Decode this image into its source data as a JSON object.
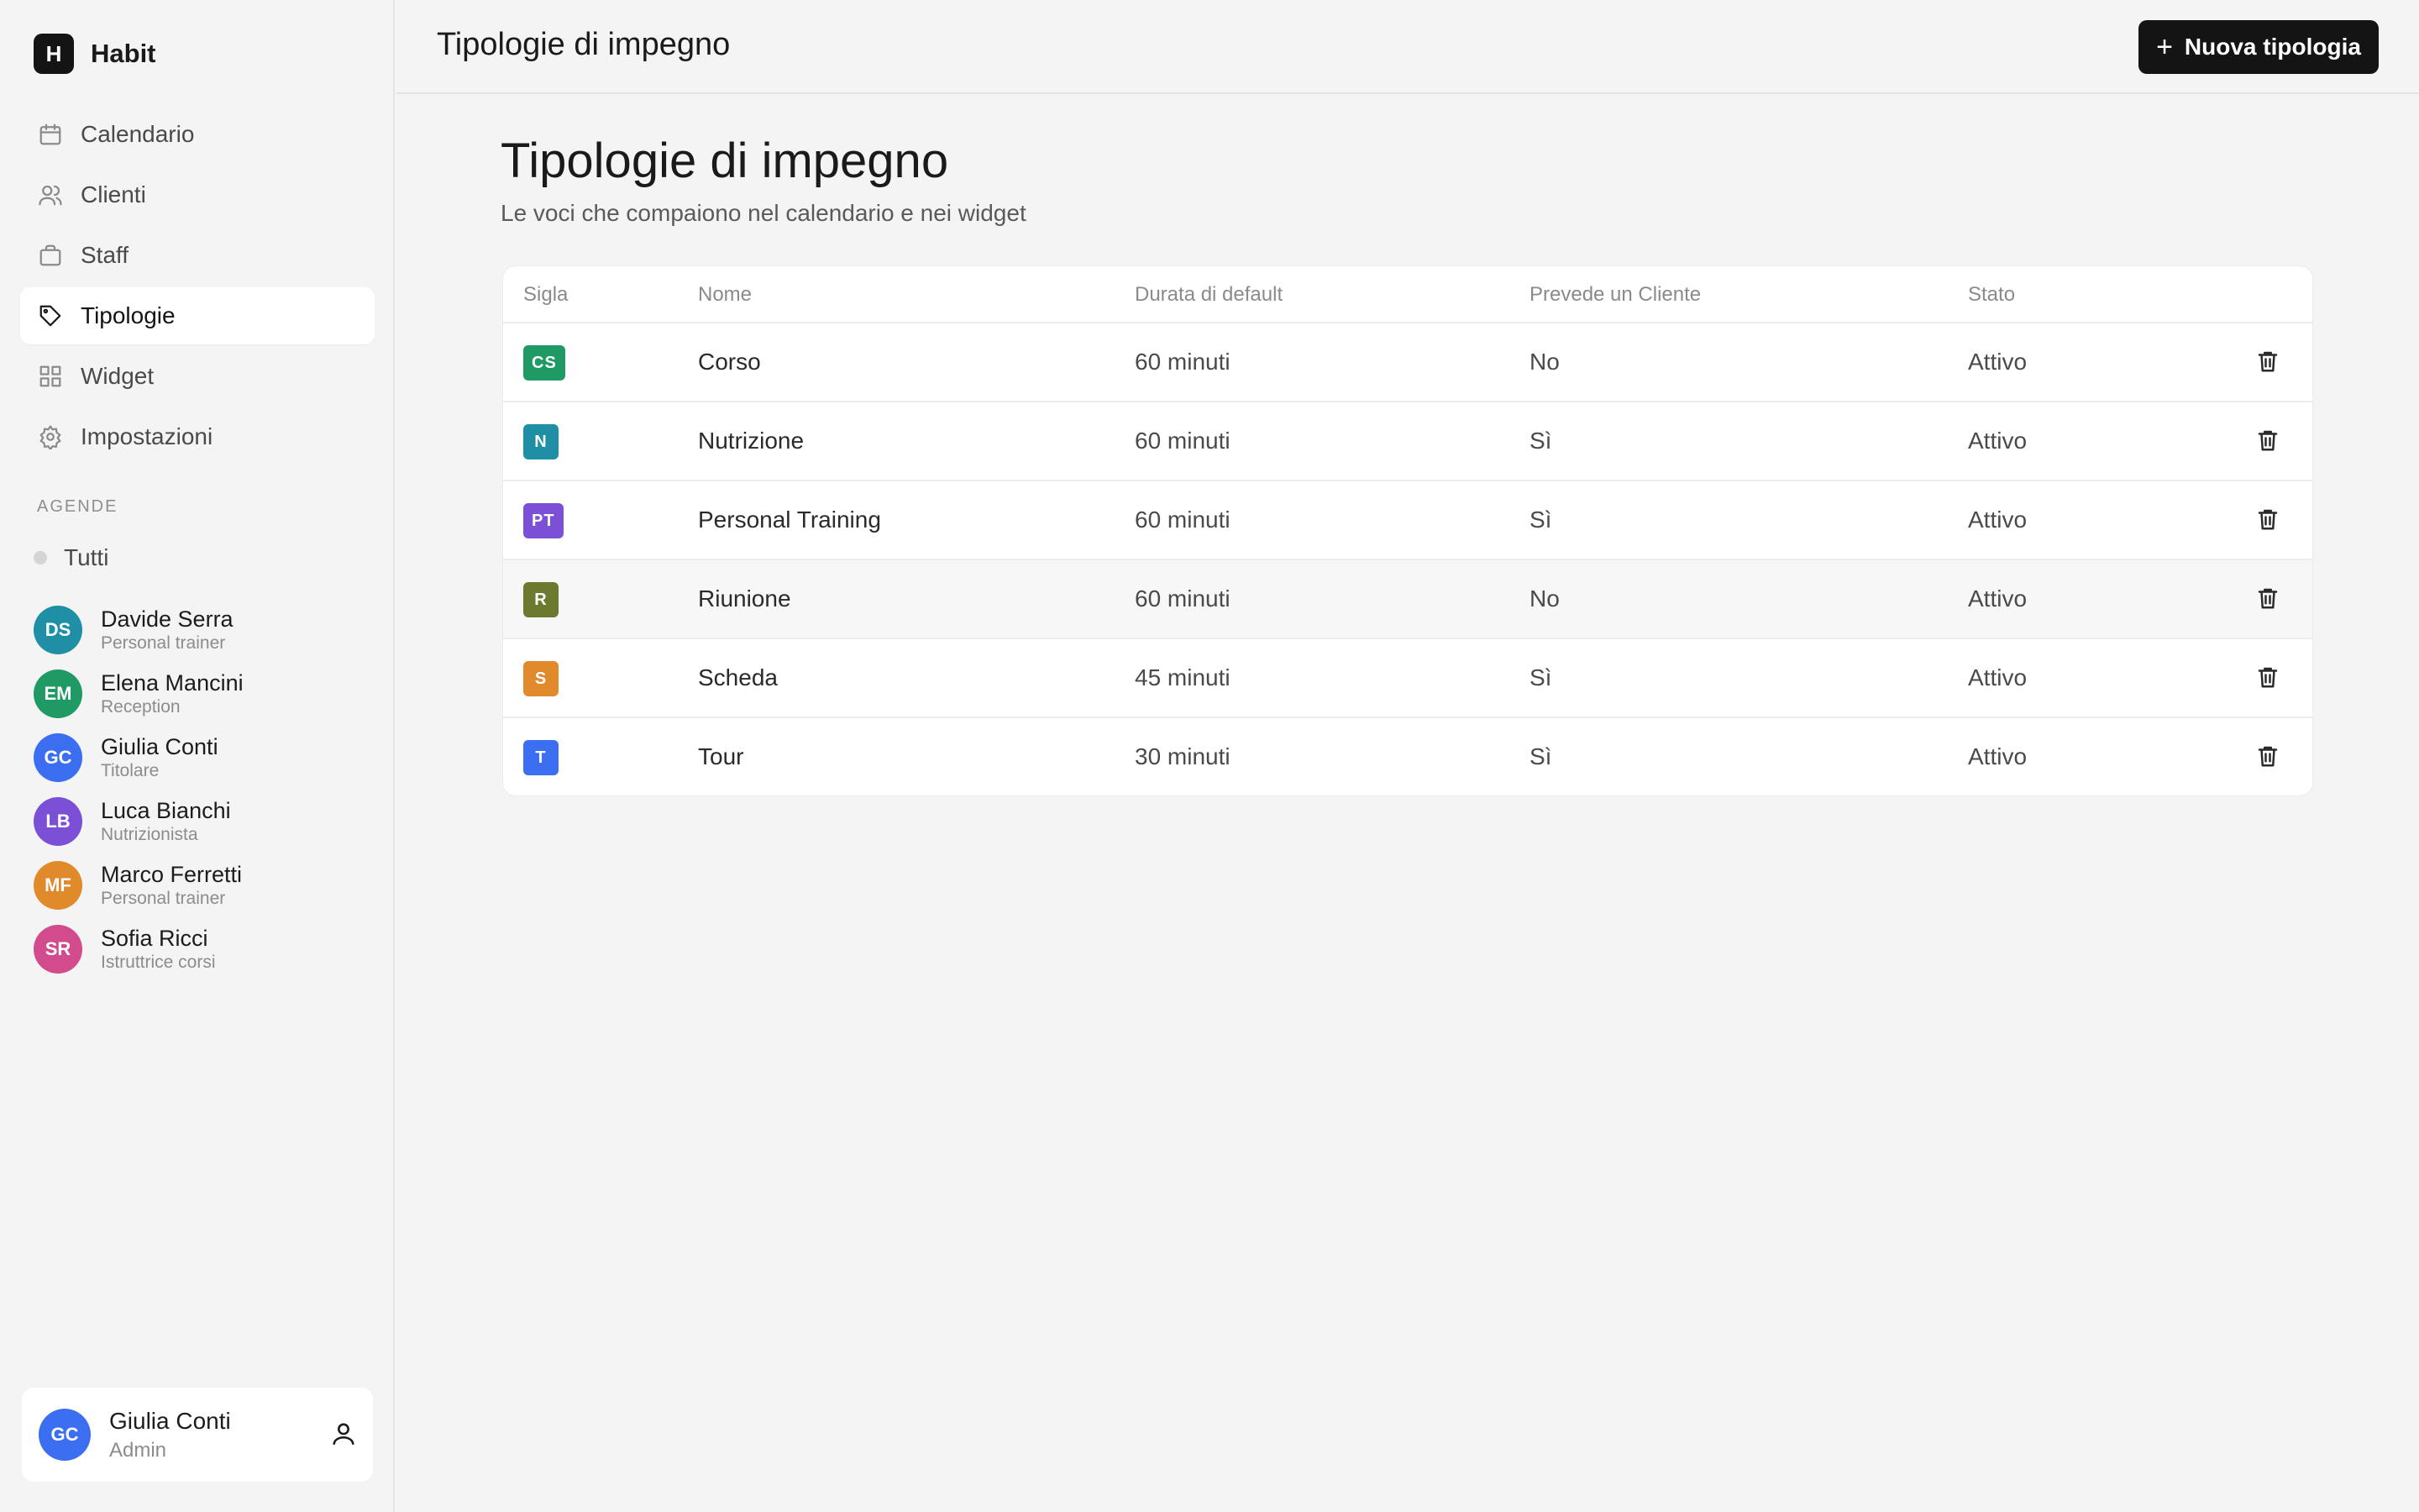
{
  "app": {
    "logo_letter": "H",
    "name": "Habit"
  },
  "nav": [
    {
      "label": "Calendario",
      "icon": "calendar-icon"
    },
    {
      "label": "Clienti",
      "icon": "users-icon"
    },
    {
      "label": "Staff",
      "icon": "briefcase-icon"
    },
    {
      "label": "Tipologie",
      "icon": "tag-icon",
      "active": true
    },
    {
      "label": "Widget",
      "icon": "grid-icon"
    },
    {
      "label": "Impostazioni",
      "icon": "gear-icon"
    }
  ],
  "agende": {
    "section_label": "AGENDE",
    "all_label": "Tutti",
    "people": [
      {
        "initials": "DS",
        "name": "Davide Serra",
        "role": "Personal trainer",
        "color": "#1f8fa6"
      },
      {
        "initials": "EM",
        "name": "Elena Mancini",
        "role": "Reception",
        "color": "#1f9a64"
      },
      {
        "initials": "GC",
        "name": "Giulia Conti",
        "role": "Titolare",
        "color": "#3b6ef0"
      },
      {
        "initials": "LB",
        "name": "Luca Bianchi",
        "role": "Nutrizionista",
        "color": "#7b4fd6"
      },
      {
        "initials": "MF",
        "name": "Marco Ferretti",
        "role": "Personal trainer",
        "color": "#e08a2c"
      },
      {
        "initials": "SR",
        "name": "Sofia Ricci",
        "role": "Istruttrice corsi",
        "color": "#d24b8c"
      }
    ]
  },
  "current_user": {
    "initials": "GC",
    "name": "Giulia Conti",
    "role": "Admin",
    "color": "#3b6ef0"
  },
  "header": {
    "title": "Tipologie di impegno",
    "new_button": "Nuova tipologia"
  },
  "page": {
    "title": "Tipologie di impegno",
    "subtitle": "Le voci che compaiono nel calendario e nei widget"
  },
  "table": {
    "columns": [
      "Sigla",
      "Nome",
      "Durata di default",
      "Prevede un Cliente",
      "Stato"
    ],
    "rows": [
      {
        "sigla": "CS",
        "color": "#1f9a64",
        "nome": "Corso",
        "durata": "60 minuti",
        "cliente": "No",
        "stato": "Attivo"
      },
      {
        "sigla": "N",
        "color": "#1f8fa6",
        "nome": "Nutrizione",
        "durata": "60 minuti",
        "cliente": "Sì",
        "stato": "Attivo"
      },
      {
        "sigla": "PT",
        "color": "#7b4fd6",
        "nome": "Personal Training",
        "durata": "60 minuti",
        "cliente": "Sì",
        "stato": "Attivo"
      },
      {
        "sigla": "R",
        "color": "#6b7a2e",
        "nome": "Riunione",
        "durata": "60 minuti",
        "cliente": "No",
        "stato": "Attivo"
      },
      {
        "sigla": "S",
        "color": "#e08a2c",
        "nome": "Scheda",
        "durata": "45 minuti",
        "cliente": "Sì",
        "stato": "Attivo"
      },
      {
        "sigla": "T",
        "color": "#3b6ef0",
        "nome": "Tour",
        "durata": "30 minuti",
        "cliente": "Sì",
        "stato": "Attivo"
      }
    ]
  }
}
